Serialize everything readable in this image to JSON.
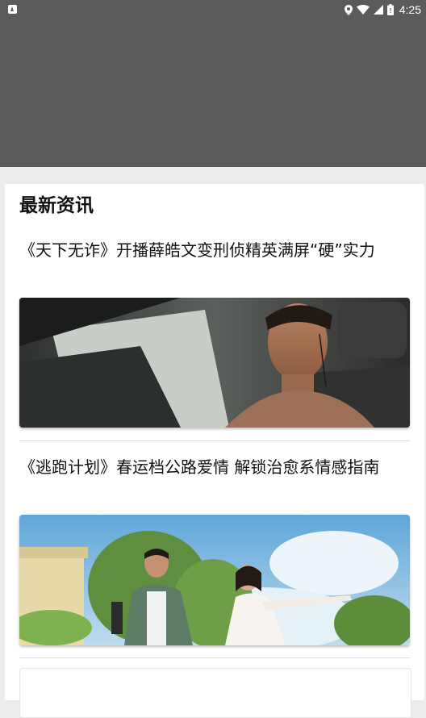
{
  "status_bar": {
    "time": "4:25",
    "icons": [
      "notification-a-icon",
      "location-icon",
      "wifi-icon",
      "signal-icon",
      "battery-icon"
    ]
  },
  "section": {
    "title": "最新资讯"
  },
  "news": [
    {
      "title": "《天下无诈》开播薛皓文变刑侦精英满屏“硬”实力",
      "image": "actor-in-car-photo"
    },
    {
      "title": "《逃跑计划》春运档公路爱情 解锁治愈系情感指南",
      "image": "couple-outdoors-photo"
    }
  ],
  "colors": {
    "header_bg": "#5b5b5b",
    "page_bg": "#ececec",
    "card_bg": "#ffffff",
    "text": "#111111"
  }
}
